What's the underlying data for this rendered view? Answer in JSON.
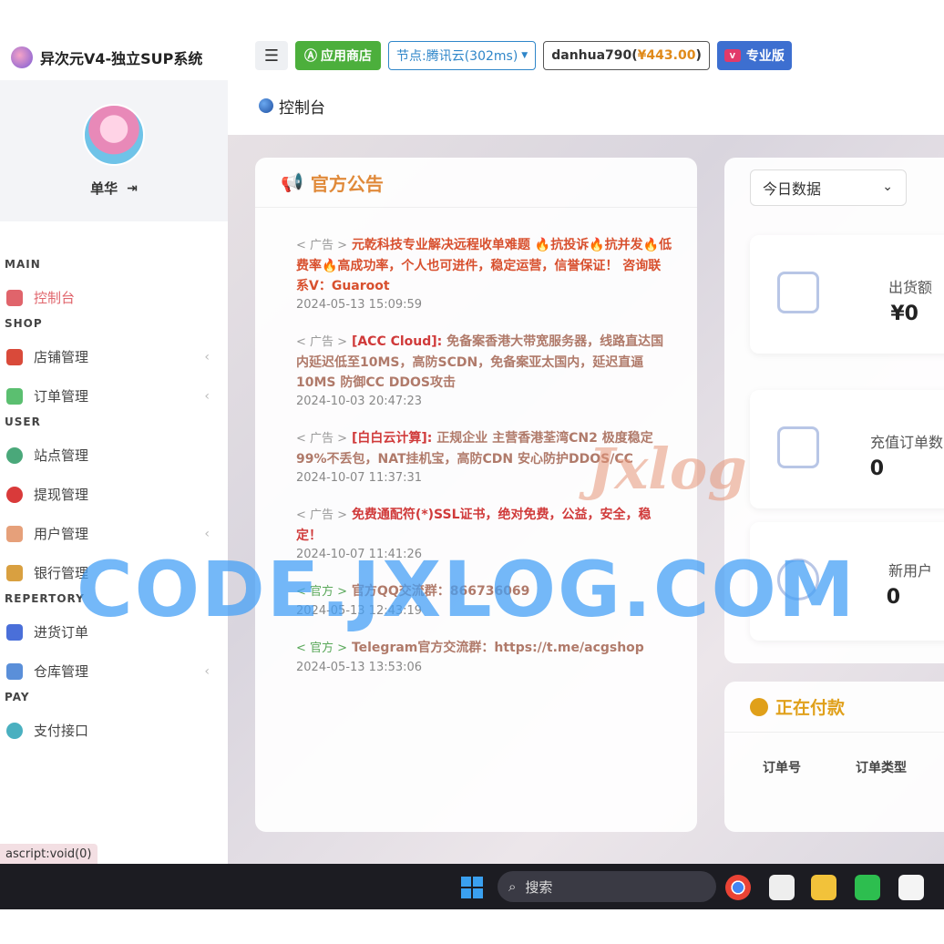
{
  "brand": {
    "title": "异次元V4-独立SUP系统"
  },
  "profile": {
    "name": "单华",
    "logout_icon": "logout-icon"
  },
  "nav": {
    "sections": [
      {
        "title": "MAIN",
        "items": [
          {
            "label": "控制台",
            "active": true,
            "chevron": false,
            "color": "#e0646b"
          }
        ]
      },
      {
        "title": "SHOP",
        "items": [
          {
            "label": "店铺管理",
            "chevron": true,
            "color": "#d94a3a"
          },
          {
            "label": "订单管理",
            "chevron": true,
            "color": "#5bbf70"
          }
        ]
      },
      {
        "title": "USER",
        "items": [
          {
            "label": "站点管理",
            "chevron": false,
            "color": "#4aa87a"
          },
          {
            "label": "提现管理",
            "chevron": false,
            "color": "#d93a3a"
          },
          {
            "label": "用户管理",
            "chevron": true,
            "color": "#e6a07a"
          },
          {
            "label": "银行管理",
            "chevron": false,
            "color": "#d9a040"
          }
        ]
      },
      {
        "title": "REPERTORY",
        "items": [
          {
            "label": "进货订单",
            "chevron": false,
            "color": "#4a6fd9"
          },
          {
            "label": "仓库管理",
            "chevron": true,
            "color": "#5a8fd9"
          }
        ]
      },
      {
        "title": "PAY",
        "items": [
          {
            "label": "支付接口",
            "chevron": false,
            "color": "#4ab0c0"
          }
        ]
      }
    ]
  },
  "toolbar": {
    "menu_glyph": "☰",
    "store_label": "应用商店",
    "node_label": "节点:腾讯云(302ms)",
    "user_name": "danhua790(",
    "user_balance": "¥443.00",
    "user_close": ")",
    "pro_badge": "V",
    "pro_label": "专业版"
  },
  "breadcrumb": {
    "title": "控制台"
  },
  "notice": {
    "title": "官方公告",
    "items": [
      {
        "tag": "< 广告 >",
        "tag_type": "ad",
        "highlight": "元乾科技专业解决远程收单难题 🔥抗投诉🔥抗并发🔥低费率🔥高成功率，个人也可进件，稳定运营，信誉保证！ 咨询联系V：Guaroot",
        "rest": "",
        "time": "2024-05-13 15:09:59"
      },
      {
        "tag": "< 广告 >",
        "tag_type": "ad",
        "highlight": "[ACC Cloud]:",
        "rest": " 免备案香港大带宽服务器，线路直达国内延迟低至10MS，高防SCDN，免备案亚太国内，延迟直逼10MS 防御CC DDOS攻击",
        "time": "2024-10-03 20:47:23"
      },
      {
        "tag": "< 广告 >",
        "tag_type": "ad",
        "highlight": "[白白云计算]:",
        "rest": " 正规企业 主营香港荃湾CN2 极度稳定 99%不丢包，NAT挂机宝，高防CDN 安心防护DDOS/CC",
        "time": "2024-10-07 11:37:31"
      },
      {
        "tag": "< 广告 >",
        "tag_type": "ad",
        "highlight": "免费通配符(*)SSL证书，绝对免费，公益，安全，稳定！",
        "rest": "",
        "time": "2024-10-07 11:41:26"
      },
      {
        "tag": "< 官方 >",
        "tag_type": "official",
        "highlight": "",
        "rest": "官方QQ交流群：866736069",
        "time": "2024-05-13 12:43:19"
      },
      {
        "tag": "< 官方 >",
        "tag_type": "official",
        "highlight": "",
        "rest": "Telegram官方交流群：https://t.me/acgshop",
        "time": "2024-05-13 13:53:06"
      }
    ]
  },
  "stats": {
    "range_selected": "今日数据",
    "cards": [
      {
        "label": "出货额",
        "value": "¥0",
        "icon": "box-icon"
      },
      {
        "label": "充值订单数",
        "value": "0",
        "icon": "recharge-order-icon"
      },
      {
        "label": "新用户",
        "value": "0",
        "icon": "new-user-icon"
      }
    ]
  },
  "paying": {
    "title": "正在付款",
    "columns": [
      "订单号",
      "订单类型"
    ]
  },
  "watermark": {
    "main": "CODE.JXLOG.COM",
    "logo": "Jxlog"
  },
  "statusbar": {
    "text": "ascript:void(0)"
  },
  "taskbar": {
    "search_placeholder": "搜索"
  }
}
